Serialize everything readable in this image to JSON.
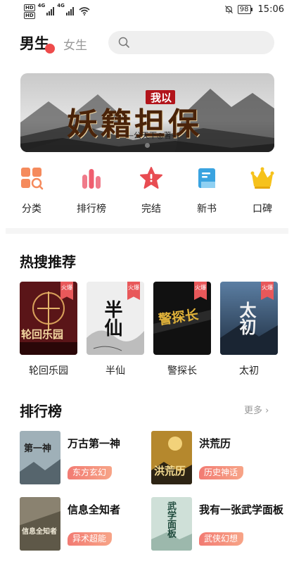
{
  "status_bar": {
    "sim1": "HD",
    "sim2": "HD",
    "net1": "4G",
    "net2": "4G",
    "battery": "98",
    "time": "15:06"
  },
  "header": {
    "tab_male": "男生",
    "tab_female": "女生",
    "search_icon": "search-icon"
  },
  "banner": {
    "small_title": "我以",
    "title": "妖籍担保",
    "author_line": "—公天下◎著—"
  },
  "categories": [
    {
      "label": "分类",
      "icon": "grid-search-icon",
      "color": "#f58a5c"
    },
    {
      "label": "排行榜",
      "icon": "bar-chart-icon",
      "color": "#ef5d6e"
    },
    {
      "label": "完结",
      "icon": "star-icon",
      "color": "#e84c52"
    },
    {
      "label": "新书",
      "icon": "book-icon",
      "color": "#3aa3e0"
    },
    {
      "label": "口碑",
      "icon": "crown-icon",
      "color": "#f6c21c"
    }
  ],
  "hot_search": {
    "title": "热搜推荐",
    "badge": "火爆",
    "books": [
      {
        "name": "轮回乐园",
        "cover_text": "轮回乐园",
        "bg": "#5a1518"
      },
      {
        "name": "半仙",
        "cover_text": "半仙",
        "bg": "#eeeeee"
      },
      {
        "name": "警探长",
        "cover_text": "警探长",
        "bg": "#111111"
      },
      {
        "name": "太初",
        "cover_text": "太初",
        "bg": "#2e4660"
      }
    ]
  },
  "ranking": {
    "title": "排行榜",
    "more": "更多",
    "books": [
      {
        "title": "万古第一神",
        "tag": "东方玄幻",
        "cover_text": "第一神",
        "bg": "#9fb0b8"
      },
      {
        "title": "洪荒历",
        "tag": "历史神话",
        "cover_text": "洪荒历",
        "bg": "#b5882d"
      },
      {
        "title": "信息全知者",
        "tag": "异术超能",
        "cover_text": "信息全知者",
        "bg": "#8a8270"
      },
      {
        "title": "我有一张武学面板",
        "tag": "武侠幻想",
        "cover_text": "武学面板",
        "bg": "#cfe0d8"
      }
    ]
  }
}
